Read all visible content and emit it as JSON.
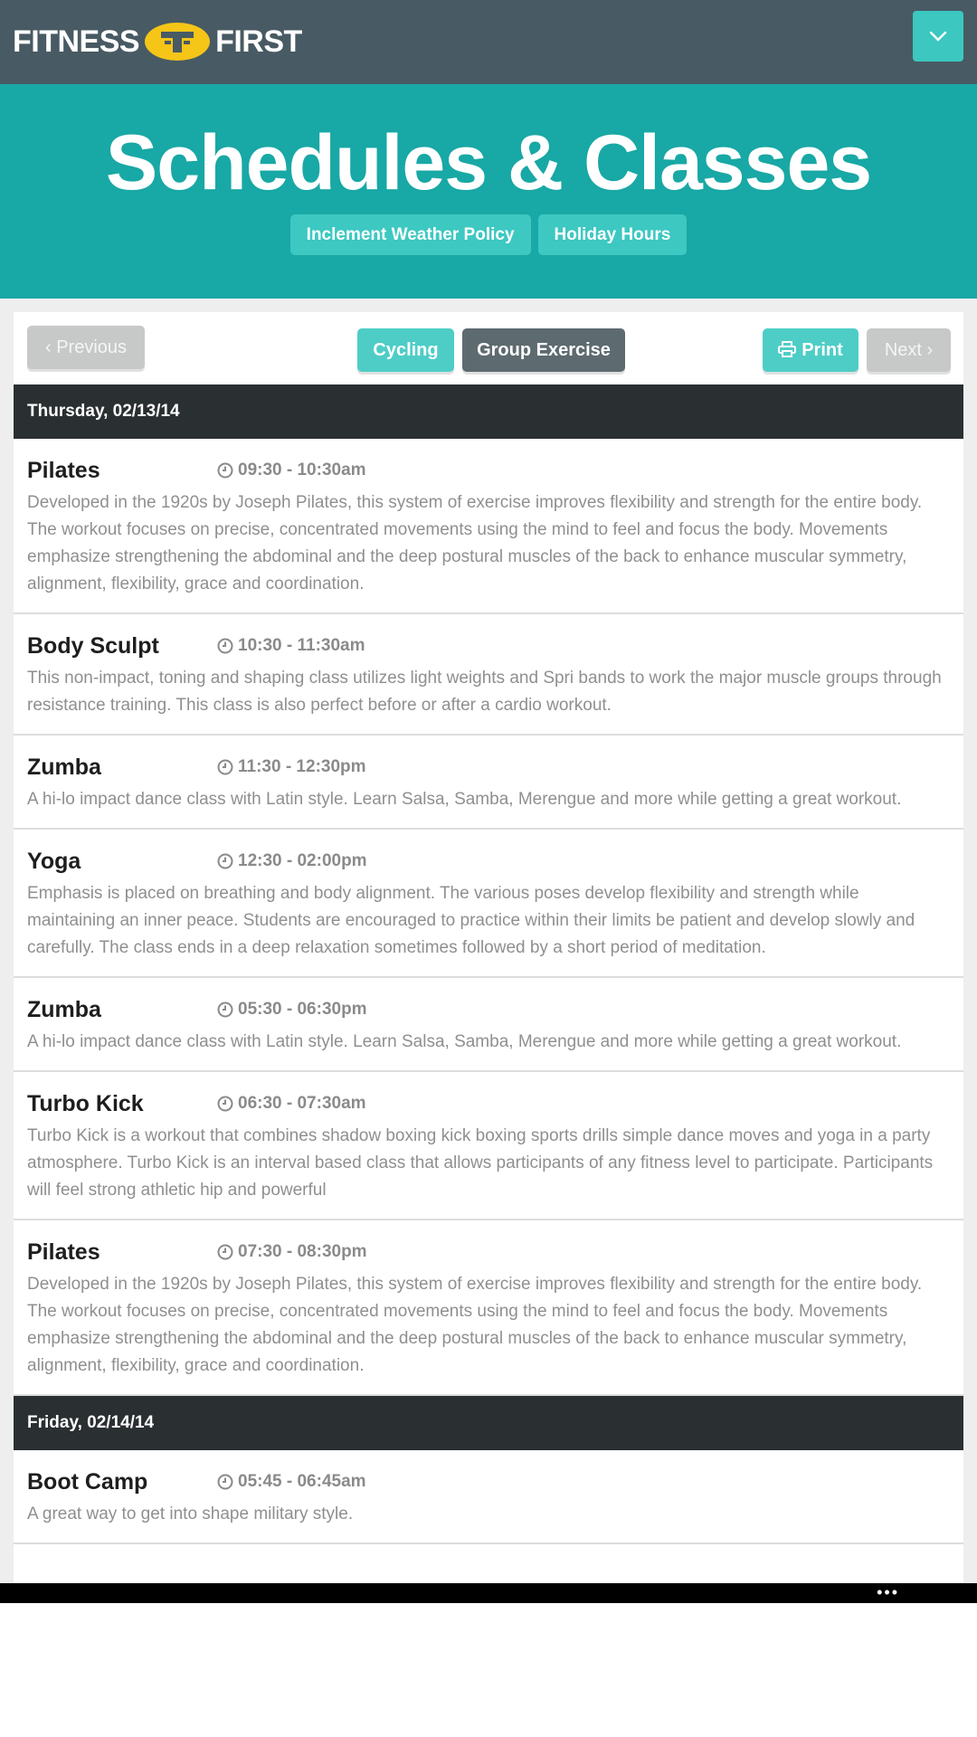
{
  "header": {
    "logo_left": "FITNESS",
    "logo_right": "FIRST"
  },
  "hero": {
    "title": "Schedules & Classes",
    "links": [
      "Inclement Weather Policy",
      "Holiday Hours"
    ]
  },
  "toolbar": {
    "previous_label": "‹ Previous",
    "cycling_label": "Cycling",
    "group_label": "Group Exercise",
    "print_label": "Print",
    "next_label": "Next ›"
  },
  "days": [
    {
      "date": "Thursday, 02/13/14",
      "classes": [
        {
          "name": "Pilates",
          "time": "09:30 - 10:30am",
          "desc": "Developed in the 1920s by Joseph Pilates, this system of exercise improves flexibility and strength for the entire body. The workout focuses on precise, concentrated movements using the mind to feel and focus the body. Movements emphasize strengthening the abdominal and the deep postural muscles of the back to enhance muscular symmetry, alignment, flexibility, grace and coordination."
        },
        {
          "name": "Body Sculpt",
          "time": "10:30 - 11:30am",
          "desc": "This non-impact, toning and shaping class utilizes light weights and Spri bands to work the major muscle groups through resistance training. This class is also perfect before or after a cardio workout."
        },
        {
          "name": "Zumba",
          "time": "11:30 - 12:30pm",
          "desc": "A hi-lo impact dance class with Latin style. Learn Salsa, Samba, Merengue and more while getting a great workout."
        },
        {
          "name": "Yoga",
          "time": "12:30 - 02:00pm",
          "desc": "Emphasis is placed on breathing and body alignment. The various poses develop flexibility and strength while maintaining an inner peace. Students are encouraged to practice within their limits be patient and develop slowly and carefully. The class ends in a deep relaxation sometimes followed by a short period of meditation."
        },
        {
          "name": "Zumba",
          "time": "05:30 - 06:30pm",
          "desc": "A hi-lo impact dance class with Latin style. Learn Salsa, Samba, Merengue and more while getting a great workout."
        },
        {
          "name": "Turbo Kick",
          "time": "06:30 - 07:30am",
          "desc": "Turbo Kick is a workout that combines shadow boxing kick boxing sports drills simple dance moves and yoga in a party atmosphere. Turbo Kick is an interval based class that allows participants of any fitness level to participate. Participants will feel strong athletic hip and powerful"
        },
        {
          "name": "Pilates",
          "time": "07:30 - 08:30pm",
          "desc": "Developed in the 1920s by Joseph Pilates, this system of exercise improves flexibility and strength for the entire body. The workout focuses on precise, concentrated movements using the mind to feel and focus the body. Movements emphasize strengthening the abdominal and the deep postural muscles of the back to enhance muscular symmetry, alignment, flexibility, grace and coordination."
        }
      ]
    },
    {
      "date": "Friday, 02/14/14",
      "classes": [
        {
          "name": "Boot Camp",
          "time": "05:45 - 06:45am",
          "desc": "A great way to get into shape military style."
        }
      ]
    }
  ],
  "system_bar": {
    "overflow_dots": "•••"
  },
  "colors": {
    "topbar": "#485a63",
    "hero": "#18a8a5",
    "accent": "#4ecdc7",
    "day_header": "#2a2f31",
    "logo_badge": "#f5c518"
  },
  "icons": [
    "fitness-first-logo-icon",
    "chevron-down-icon",
    "print-icon",
    "clock-icon"
  ]
}
